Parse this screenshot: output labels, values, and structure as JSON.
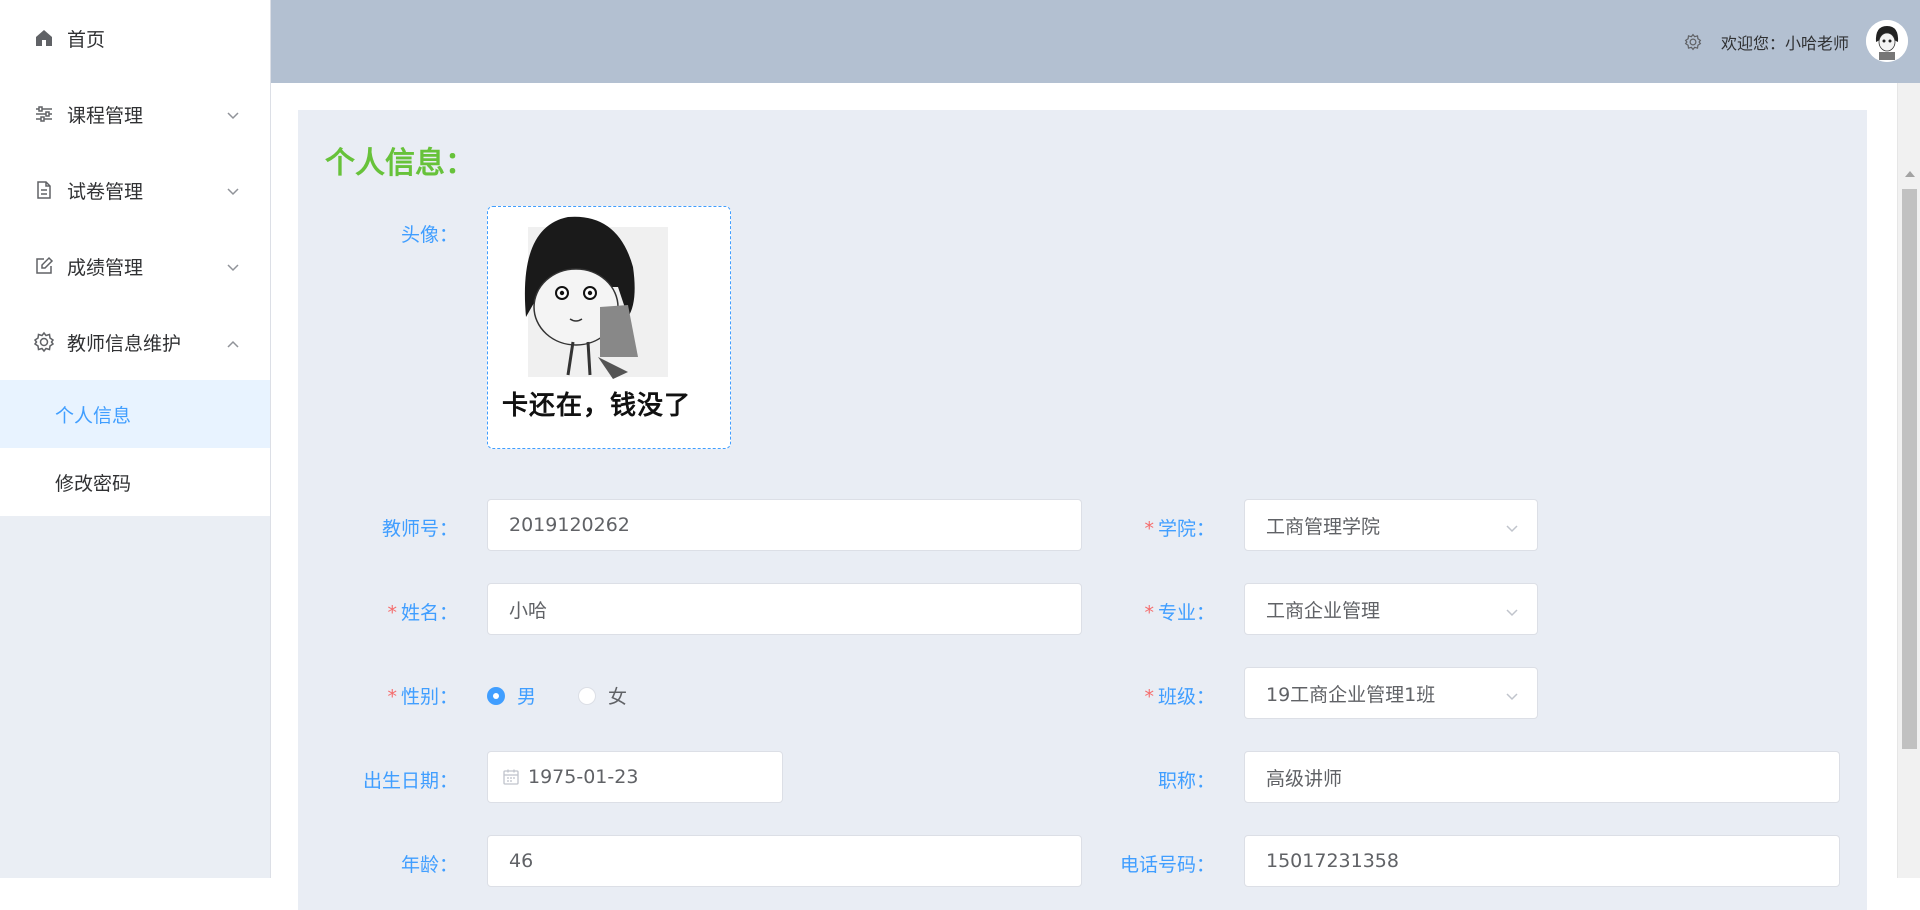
{
  "sidebar": {
    "items": [
      {
        "label": "首页",
        "icon": "home-icon"
      },
      {
        "label": "课程管理",
        "icon": "sliders-icon"
      },
      {
        "label": "试卷管理",
        "icon": "document-icon"
      },
      {
        "label": "成绩管理",
        "icon": "edit-icon"
      },
      {
        "label": "教师信息维护",
        "icon": "gear-icon"
      }
    ],
    "subitems": [
      {
        "label": "个人信息",
        "active": true
      },
      {
        "label": "修改密码",
        "active": false
      }
    ]
  },
  "header": {
    "welcome": "欢迎您：小哈老师"
  },
  "panel": {
    "title": "个人信息：",
    "avatar_label": "头像：",
    "avatar_caption": "卡还在，钱没了"
  },
  "form": {
    "teacher_no": {
      "label": "教师号：",
      "value": "2019120262"
    },
    "college": {
      "label": "学院：",
      "value": "工商管理学院",
      "required": "*"
    },
    "name": {
      "label": "姓名：",
      "value": "小哈",
      "required": "*"
    },
    "major": {
      "label": "专业：",
      "value": "工商企业管理",
      "required": "*"
    },
    "gender": {
      "label": "性别：",
      "required": "*",
      "options": [
        "男",
        "女"
      ],
      "selected": "男"
    },
    "class": {
      "label": "班级：",
      "value": "19工商企业管理1班",
      "required": "*"
    },
    "birth": {
      "label": "出生日期：",
      "value": "1975-01-23"
    },
    "title": {
      "label": "职称：",
      "value": "高级讲师"
    },
    "age": {
      "label": "年龄：",
      "value": "46"
    },
    "phone": {
      "label": "电话号码：",
      "value": "15017231358"
    }
  },
  "colors": {
    "accent": "#409eff",
    "title_green": "#67c23a",
    "required_red": "#f56c6c",
    "header_bg": "#b3c0d1"
  }
}
